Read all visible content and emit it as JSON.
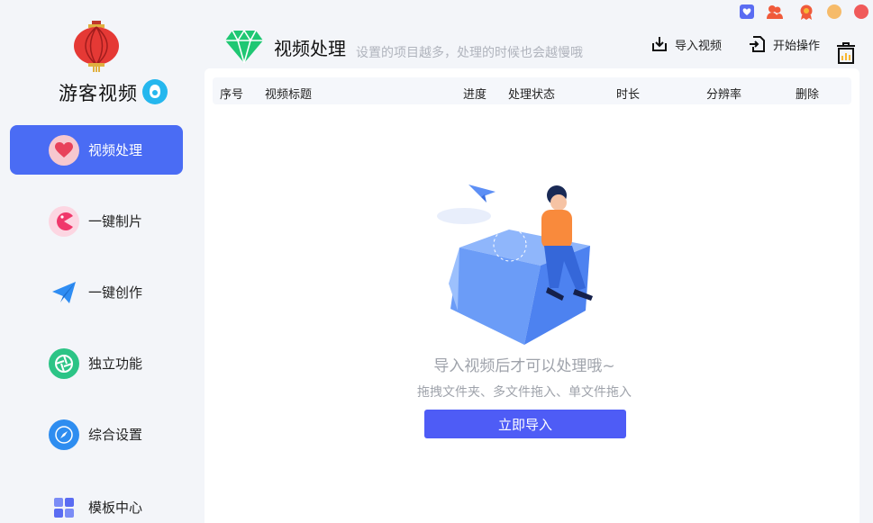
{
  "app": {
    "name": "游客视频"
  },
  "sidebar": {
    "items": [
      {
        "label": "视频处理",
        "icon": "heart-icon",
        "active": true
      },
      {
        "label": "一键制片",
        "icon": "pacman-icon",
        "active": false
      },
      {
        "label": "一键创作",
        "icon": "paper-plane-icon",
        "active": false
      },
      {
        "label": "独立功能",
        "icon": "aperture-icon",
        "active": false
      },
      {
        "label": "综合设置",
        "icon": "compass-icon",
        "active": false
      },
      {
        "label": "模板中心",
        "icon": "grid-icon",
        "active": false
      }
    ]
  },
  "header": {
    "title": "视频处理",
    "subtitle": "设置的项目越多，处理的时候也会越慢哦",
    "import_label": "导入视频",
    "start_label": "开始操作"
  },
  "table": {
    "columns": [
      "序号",
      "视频标题",
      "进度",
      "处理状态",
      "时长",
      "分辨率",
      "删除"
    ]
  },
  "empty": {
    "title": "导入视频后才可以处理哦~",
    "subtitle": "拖拽文件夹、多文件拖入、单文件拖入",
    "button_label": "立即导入"
  },
  "colors": {
    "accent": "#4a6cf4",
    "button": "#4e5cf6",
    "background": "#f3f5f9"
  }
}
